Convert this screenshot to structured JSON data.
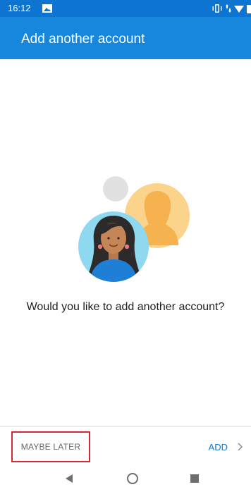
{
  "status_bar": {
    "time": "16:12",
    "icons": [
      "image-icon",
      "vibrate-icon",
      "data-arrows-icon",
      "wifi-icon",
      "battery-icon"
    ]
  },
  "app_bar": {
    "title": "Add another account"
  },
  "illustration": {
    "icon": "accounts-illustration"
  },
  "prompt": {
    "question": "Would you like to add another account?"
  },
  "actions": {
    "maybe_later_label": "MAYBE LATER",
    "add_label": "ADD",
    "add_icon": "chevron-right-icon"
  },
  "nav": {
    "icons": [
      "back-icon",
      "home-icon",
      "recents-icon"
    ]
  },
  "colors": {
    "status_bar": "#0e74d1",
    "app_bar": "#1787de",
    "accent": "#1178d6",
    "highlight": "#d9283a"
  }
}
